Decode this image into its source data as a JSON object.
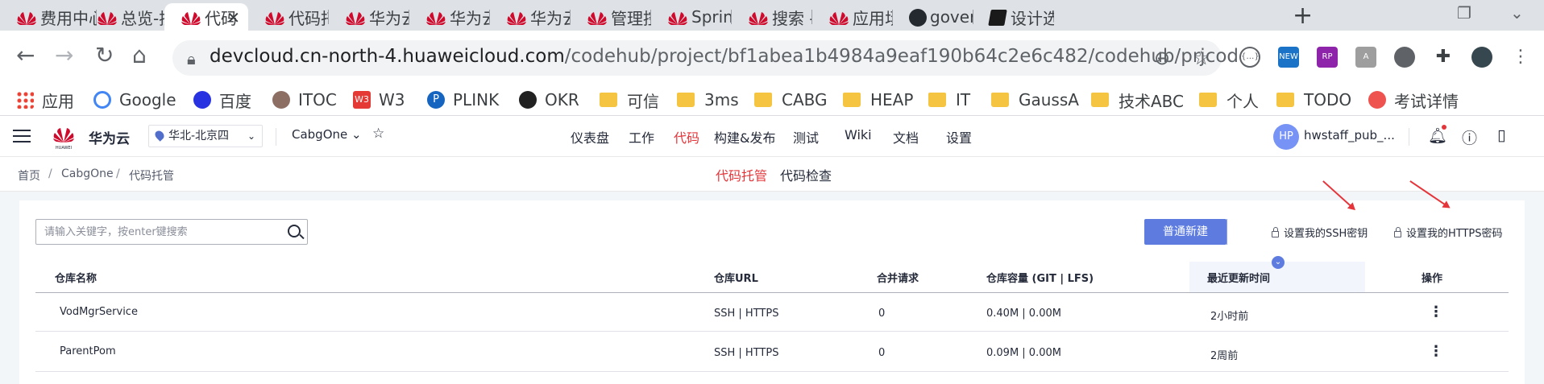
{
  "browser": {
    "tabs": [
      {
        "label": "费用中心",
        "icon": "huawei-icon"
      },
      {
        "label": "总览-控",
        "icon": "huawei-icon"
      },
      {
        "label": "代码",
        "icon": "huawei-icon",
        "active": true,
        "close": "✕"
      },
      {
        "label": "代码托管",
        "icon": "huawei-icon"
      },
      {
        "label": "华为云-",
        "icon": "huawei-icon"
      },
      {
        "label": "华为云-",
        "icon": "huawei-icon"
      },
      {
        "label": "华为云-",
        "icon": "huawei-icon"
      },
      {
        "label": "管理控制",
        "icon": "huawei-icon"
      },
      {
        "label": "Spring",
        "icon": "huawei-icon"
      },
      {
        "label": "搜索 - ",
        "icon": "huawei-icon"
      },
      {
        "label": "应用场景",
        "icon": "huawei-icon"
      },
      {
        "label": "govern",
        "icon": "github-icon"
      },
      {
        "label": "设计选型",
        "icon": "book-icon"
      }
    ],
    "new_tab": "+",
    "url_host": "devcloud.cn-north-4.huaweicloud.com",
    "url_path": "/codehub/project/bf1abea1b4984a9eaf190b64c2e6c482/codehub/prjcode",
    "bookmarks": [
      {
        "label": "应用",
        "icon": "apps-grid-icon"
      },
      {
        "label": "Google",
        "icon": "google-icon"
      },
      {
        "label": "百度",
        "icon": "baidu-icon"
      },
      {
        "label": "ITOC",
        "icon": "itoc-icon"
      },
      {
        "label": "W3",
        "icon": "w3-icon"
      },
      {
        "label": "PLINK",
        "icon": "plink-icon"
      },
      {
        "label": "OKR",
        "icon": "okr-icon"
      },
      {
        "label": "可信",
        "icon": "folder-icon"
      },
      {
        "label": "3ms",
        "icon": "folder-icon"
      },
      {
        "label": "CABG",
        "icon": "folder-icon"
      },
      {
        "label": "HEAP",
        "icon": "folder-icon"
      },
      {
        "label": "IT",
        "icon": "folder-icon"
      },
      {
        "label": "GaussA",
        "icon": "folder-icon"
      },
      {
        "label": "技术ABC",
        "icon": "folder-icon"
      },
      {
        "label": "个人",
        "icon": "folder-icon"
      },
      {
        "label": "TODO",
        "icon": "folder-icon"
      },
      {
        "label": "考试详情",
        "icon": "exam-icon"
      }
    ],
    "extensions": [
      "NEW",
      "RP"
    ]
  },
  "app": {
    "brand_logo_text": "HUAWEI",
    "brand": "华为云",
    "region": "华北-北京四",
    "project": "CabgOne",
    "project_caret": "⌄",
    "nav": [
      {
        "label": "仪表盘"
      },
      {
        "label": "工作"
      },
      {
        "label": "代码",
        "active": true
      },
      {
        "label": "构建&发布"
      },
      {
        "label": "测试"
      },
      {
        "label": "Wiki"
      },
      {
        "label": "文档"
      },
      {
        "label": "设置"
      }
    ],
    "avatar": "HP",
    "username": "hwstaff_pub_...",
    "accent": "#e5353a",
    "primary": "#5e7ce0"
  },
  "breadcrumb": [
    "首页",
    "CabgOne",
    "代码托管"
  ],
  "subtabs": [
    {
      "label": "代码托管",
      "active": true
    },
    {
      "label": "代码检查"
    }
  ],
  "toolbar": {
    "search_placeholder": "请输入关键字，按enter键搜索",
    "new_button": "普通新建",
    "ssh_link": "设置我的SSH密钥",
    "https_link": "设置我的HTTPS密码"
  },
  "table": {
    "columns": [
      "仓库名称",
      "仓库URL",
      "合并请求",
      "仓库容量 (GIT | LFS)",
      "最近更新时间",
      "操作"
    ],
    "rows": [
      {
        "name": "VodMgrService",
        "url": "SSH | HTTPS",
        "mr": "0",
        "size": "0.40M  |  0.00M",
        "updated": "2小时前",
        "more": "⋮"
      },
      {
        "name": "ParentPom",
        "url": "SSH | HTTPS",
        "mr": "0",
        "size": "0.09M  |  0.00M",
        "updated": "2周前",
        "more": "⋮"
      }
    ]
  }
}
